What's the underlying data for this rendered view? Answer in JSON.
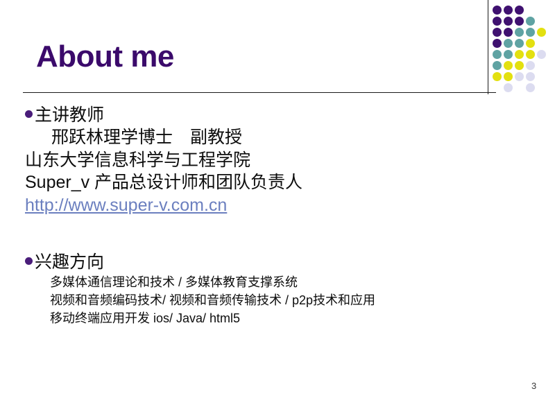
{
  "slide": {
    "title": "About me",
    "page_number": "3",
    "title_color": "#3B0A6B",
    "bullet_color": "#4A1D7A",
    "link_color": "#6B7FBF"
  },
  "sections": [
    {
      "bullet": "主讲教师",
      "lines": [
        {
          "text": "邢跃林理学博士　副教授",
          "style": "indent"
        },
        {
          "text": "山东大学信息科学与工程学院",
          "style": "plain"
        },
        {
          "text": "Super_v 产品总设计师和团队负责人",
          "style": "plain"
        },
        {
          "text": "http://www.super-v.com.cn",
          "style": "link"
        }
      ]
    },
    {
      "bullet": "兴趣方向",
      "lines": [
        {
          "text": "多媒体通信理论和技术 / 多媒体教育支撑系统",
          "style": "sub"
        },
        {
          "text": "视频和音频编码技术/ 视频和音频传输技术 / p2p技术和应用",
          "style": "sub"
        },
        {
          "text": "移动终端应用开发 ios/ Java/ html5",
          "style": "sub"
        }
      ]
    }
  ],
  "decoration": {
    "name": "dot-grid",
    "colors": {
      "purple": "#3F1170",
      "teal": "#5FA3A3",
      "yellow": "#E3E010",
      "lavender": "#DCDCF0"
    },
    "cell": 16,
    "dots": [
      {
        "col": 0,
        "row": 0,
        "color": "purple"
      },
      {
        "col": 1,
        "row": 0,
        "color": "purple"
      },
      {
        "col": 2,
        "row": 0,
        "color": "purple"
      },
      {
        "col": 0,
        "row": 1,
        "color": "purple"
      },
      {
        "col": 1,
        "row": 1,
        "color": "purple"
      },
      {
        "col": 2,
        "row": 1,
        "color": "purple"
      },
      {
        "col": 3,
        "row": 1,
        "color": "teal"
      },
      {
        "col": 0,
        "row": 2,
        "color": "purple"
      },
      {
        "col": 1,
        "row": 2,
        "color": "purple"
      },
      {
        "col": 2,
        "row": 2,
        "color": "teal"
      },
      {
        "col": 3,
        "row": 2,
        "color": "teal"
      },
      {
        "col": 4,
        "row": 2,
        "color": "yellow"
      },
      {
        "col": 0,
        "row": 3,
        "color": "purple"
      },
      {
        "col": 1,
        "row": 3,
        "color": "teal"
      },
      {
        "col": 2,
        "row": 3,
        "color": "teal"
      },
      {
        "col": 3,
        "row": 3,
        "color": "yellow"
      },
      {
        "col": 0,
        "row": 4,
        "color": "teal"
      },
      {
        "col": 1,
        "row": 4,
        "color": "teal"
      },
      {
        "col": 2,
        "row": 4,
        "color": "yellow"
      },
      {
        "col": 3,
        "row": 4,
        "color": "yellow"
      },
      {
        "col": 4,
        "row": 4,
        "color": "lavender"
      },
      {
        "col": 0,
        "row": 5,
        "color": "teal"
      },
      {
        "col": 1,
        "row": 5,
        "color": "yellow"
      },
      {
        "col": 2,
        "row": 5,
        "color": "yellow"
      },
      {
        "col": 3,
        "row": 5,
        "color": "lavender"
      },
      {
        "col": 0,
        "row": 6,
        "color": "yellow"
      },
      {
        "col": 1,
        "row": 6,
        "color": "yellow"
      },
      {
        "col": 2,
        "row": 6,
        "color": "lavender"
      },
      {
        "col": 3,
        "row": 6,
        "color": "lavender"
      },
      {
        "col": 1,
        "row": 7,
        "color": "lavender"
      },
      {
        "col": 3,
        "row": 7,
        "color": "lavender"
      }
    ]
  }
}
